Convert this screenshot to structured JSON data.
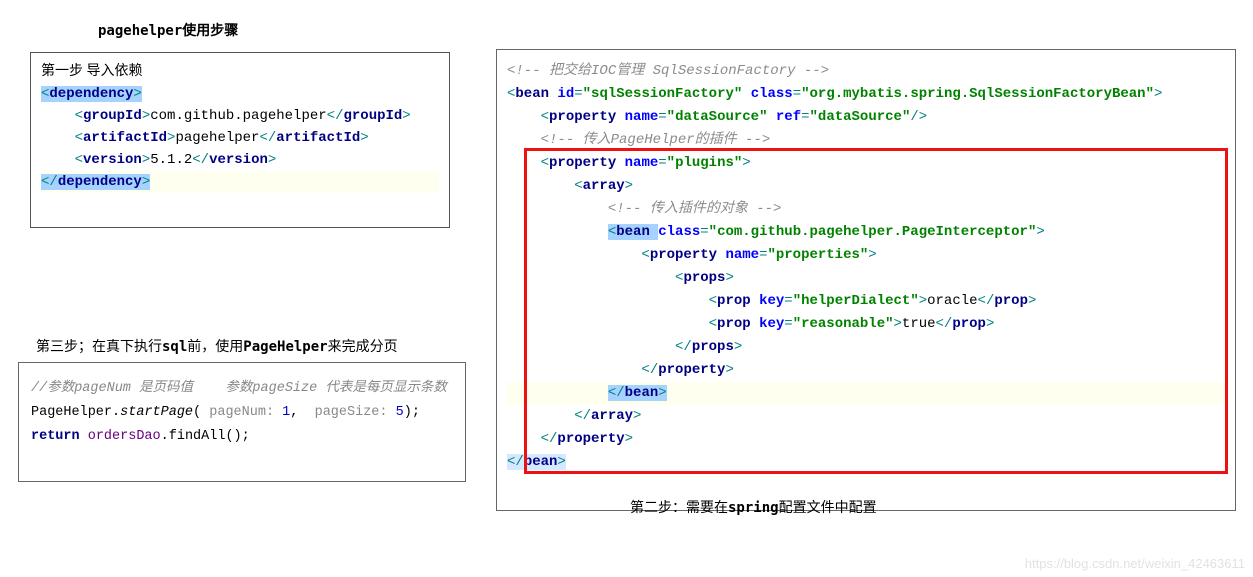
{
  "title": "pagehelper使用步骤",
  "step1": {
    "caption": "第一步 导入依赖",
    "deps": {
      "dependency_open": "<dependency>",
      "groupId_open": "<groupId>",
      "groupId_val": "com.github.pagehelper",
      "groupId_close": "</groupId>",
      "artifactId_open": "<artifactId>",
      "artifactId_val": "pagehelper",
      "artifactId_close": "</artifactId>",
      "version_open": "<version>",
      "version_val": "5.1.2",
      "version_close": "</version>",
      "dependency_close": "</dependency>"
    }
  },
  "step3": {
    "caption_pre": "第三步；在真下执行",
    "caption_sql": "sql",
    "caption_mid": "前，使用",
    "caption_ph": "PageHelper",
    "caption_post": "来完成分页",
    "comment1_pre": "//参数",
    "comment1_pn": "pageNum ",
    "comment1_a": "是页码值    参数",
    "comment1_ps": "pageSize ",
    "comment1_b": "代表是每页显示条数",
    "line2_a": "PageHelper.",
    "line2_m": "startPage",
    "line2_p1lbl": "pageNum: ",
    "line2_p1v": "1",
    "line2_p2lbl": "pageSize: ",
    "line2_p2v": "5",
    "line3_ret": "return ",
    "line3_obj": "ordersDao",
    "line3_dot": ".findAll();"
  },
  "step2": {
    "cmt1_a": "<!-- 把交给",
    "cmt1_b": "IOC",
    "cmt1_c": "管理 ",
    "cmt1_d": "SqlSessionFactory -->",
    "bean_open_id": "sqlSessionFactory",
    "bean_open_class": "org.mybatis.spring.SqlSessionFactoryBean",
    "prop_ds_name": "dataSource",
    "prop_ds_ref": "dataSource",
    "cmt2_a": "<!-- 传入",
    "cmt2_b": "PageHelper",
    "cmt2_c": "的插件 -->",
    "plugins_name": "plugins",
    "cmt3": "<!-- 传入插件的对象 -->",
    "interceptor_class": "com.github.pagehelper.PageInterceptor",
    "props_name": "properties",
    "prop_key1": "helperDialect",
    "prop_val1": "oracle",
    "prop_key2": "reasonable",
    "prop_val2": "true",
    "caption_pre": "第二步：需要在",
    "caption_b": "spring",
    "caption_post": "配置文件中配置"
  },
  "watermark": "https://blog.csdn.net/weixin_42463611"
}
